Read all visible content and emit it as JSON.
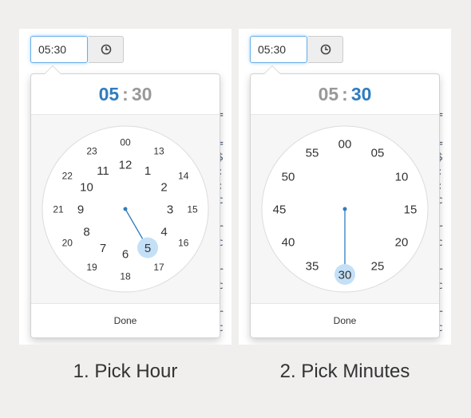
{
  "panels": [
    {
      "input_value": "05:30",
      "header": {
        "hour": "05",
        "separator": ":",
        "minute": "30",
        "active": "hour"
      },
      "dial": {
        "mode": "hour",
        "outer_labels": [
          "00",
          "13",
          "14",
          "15",
          "16",
          "17",
          "18",
          "19",
          "20",
          "21",
          "22",
          "23"
        ],
        "inner_labels": [
          "12",
          "1",
          "2",
          "3",
          "4",
          "5",
          "6",
          "7",
          "8",
          "9",
          "10",
          "11"
        ],
        "selected_label": "5"
      },
      "done_label": "Done",
      "caption": "1. Pick Hour"
    },
    {
      "input_value": "05:30",
      "header": {
        "hour": "05",
        "separator": ":",
        "minute": "30",
        "active": "minute"
      },
      "dial": {
        "mode": "minute",
        "labels": [
          "00",
          "05",
          "10",
          "15",
          "20",
          "25",
          "30",
          "35",
          "40",
          "45",
          "50",
          "55"
        ],
        "selected_label": "30"
      },
      "done_label": "Done",
      "caption": "2. Pick Minutes"
    }
  ],
  "icons": {
    "addon": "clock-icon"
  },
  "colors": {
    "accent": "#2f7cc0",
    "highlight": "#c3e0f7",
    "muted": "#999999"
  },
  "background_text_lines": [
    "=",
    "",
    "=",
    "$",
    ":",
    ":",
    "c",
    "",
    "r",
    "c",
    "",
    "r",
    "c",
    "",
    "r",
    "c",
    "",
    "r"
  ]
}
